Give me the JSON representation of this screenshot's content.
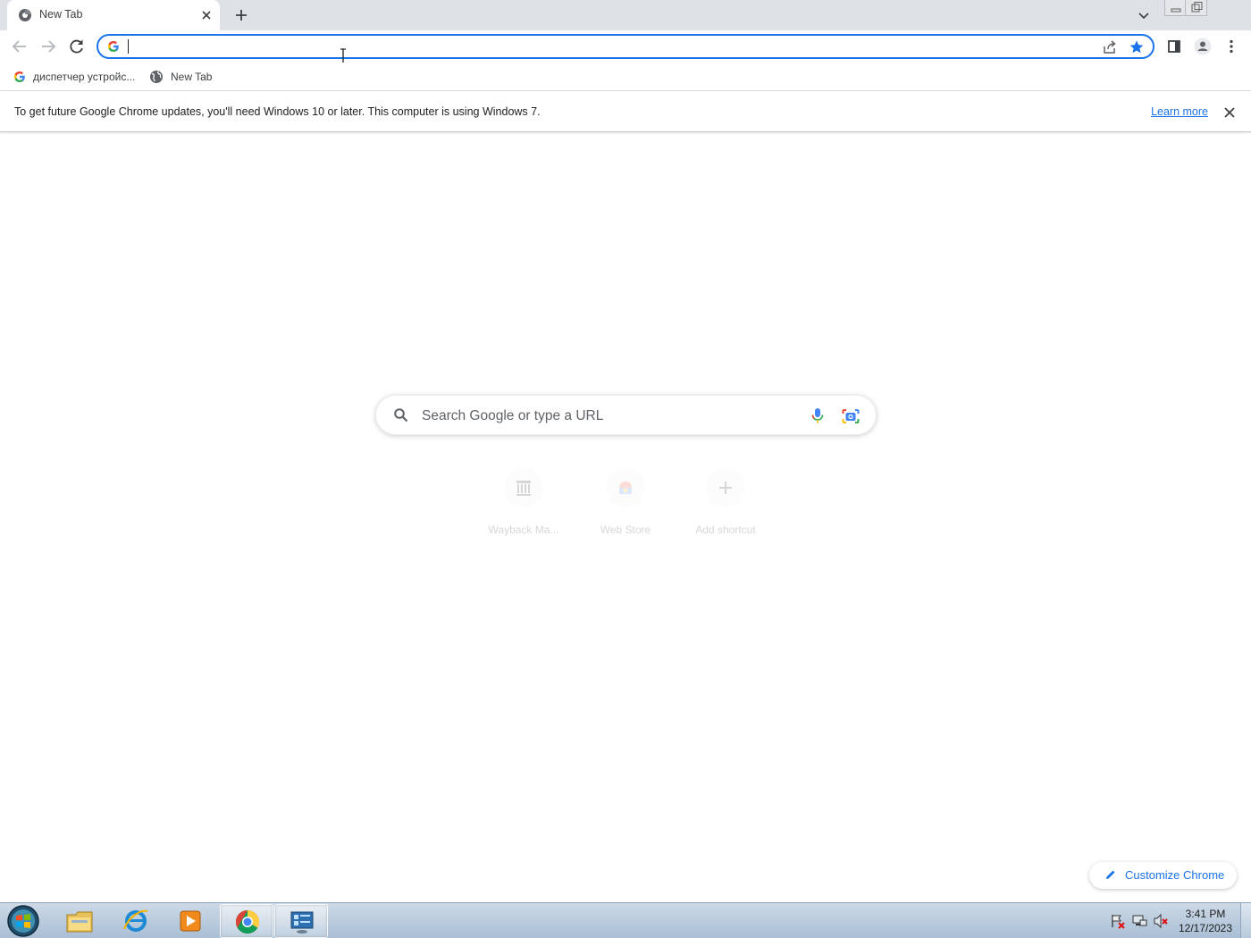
{
  "browser": {
    "tab": {
      "title": "New Tab"
    },
    "omnibox": {
      "value": ""
    },
    "bookmarks": [
      {
        "label": "диспетчер устройс...",
        "icon": "google-g-icon"
      },
      {
        "label": "New Tab",
        "icon": "globe-icon"
      }
    ],
    "infobar": {
      "message": "To get future Google Chrome updates, you'll need Windows 10 or later. This computer is using Windows 7.",
      "link_label": "Learn more"
    }
  },
  "ntp": {
    "search_placeholder": "Search Google or type a URL",
    "shortcuts": [
      {
        "label": "Wayback Ma..."
      },
      {
        "label": "Web Store"
      },
      {
        "label": "Add shortcut"
      }
    ],
    "customize_label": "Customize Chrome"
  },
  "taskbar": {
    "clock": {
      "time": "3:41 PM",
      "date": "12/17/2023"
    }
  },
  "colors": {
    "accent": "#1a73e8",
    "tabstrip": "#dee1e6",
    "taskbar": "#a9bfd5"
  }
}
